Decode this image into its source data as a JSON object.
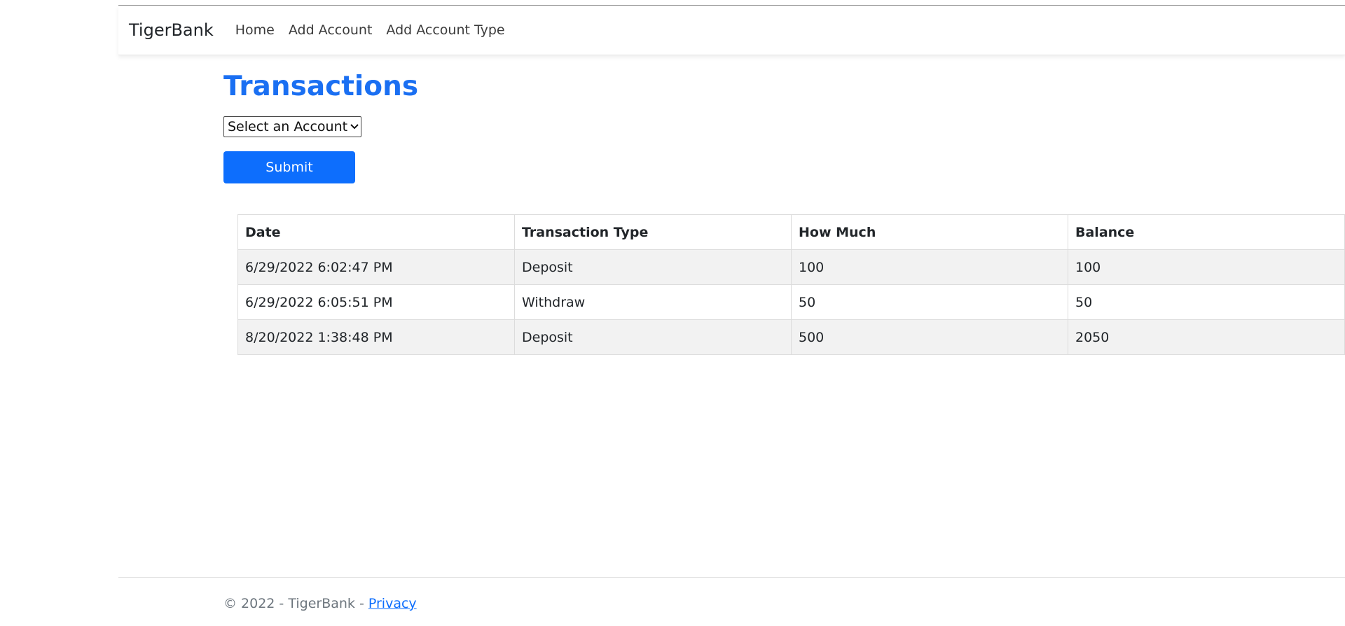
{
  "navbar": {
    "brand": "TigerBank",
    "links": [
      {
        "label": "Home"
      },
      {
        "label": "Add Account"
      },
      {
        "label": "Add Account Type"
      }
    ]
  },
  "main": {
    "title": "Transactions",
    "account_select": {
      "selected": "Select an Account"
    },
    "submit_label": "Submit"
  },
  "table": {
    "headers": [
      "Date",
      "Transaction Type",
      "How Much",
      "Balance"
    ],
    "rows": [
      [
        "6/29/2022 6:02:47 PM",
        "Deposit",
        "100",
        "100"
      ],
      [
        "6/29/2022 6:05:51 PM",
        "Withdraw",
        "50",
        "50"
      ],
      [
        "8/20/2022 1:38:48 PM",
        "Deposit",
        "500",
        "2050"
      ]
    ]
  },
  "footer": {
    "text": "© 2022 - TigerBank - ",
    "privacy_label": "Privacy"
  },
  "colors": {
    "title": "#1a6ff2",
    "button": "#0d6efd",
    "stripe": "#f2f2f2"
  }
}
